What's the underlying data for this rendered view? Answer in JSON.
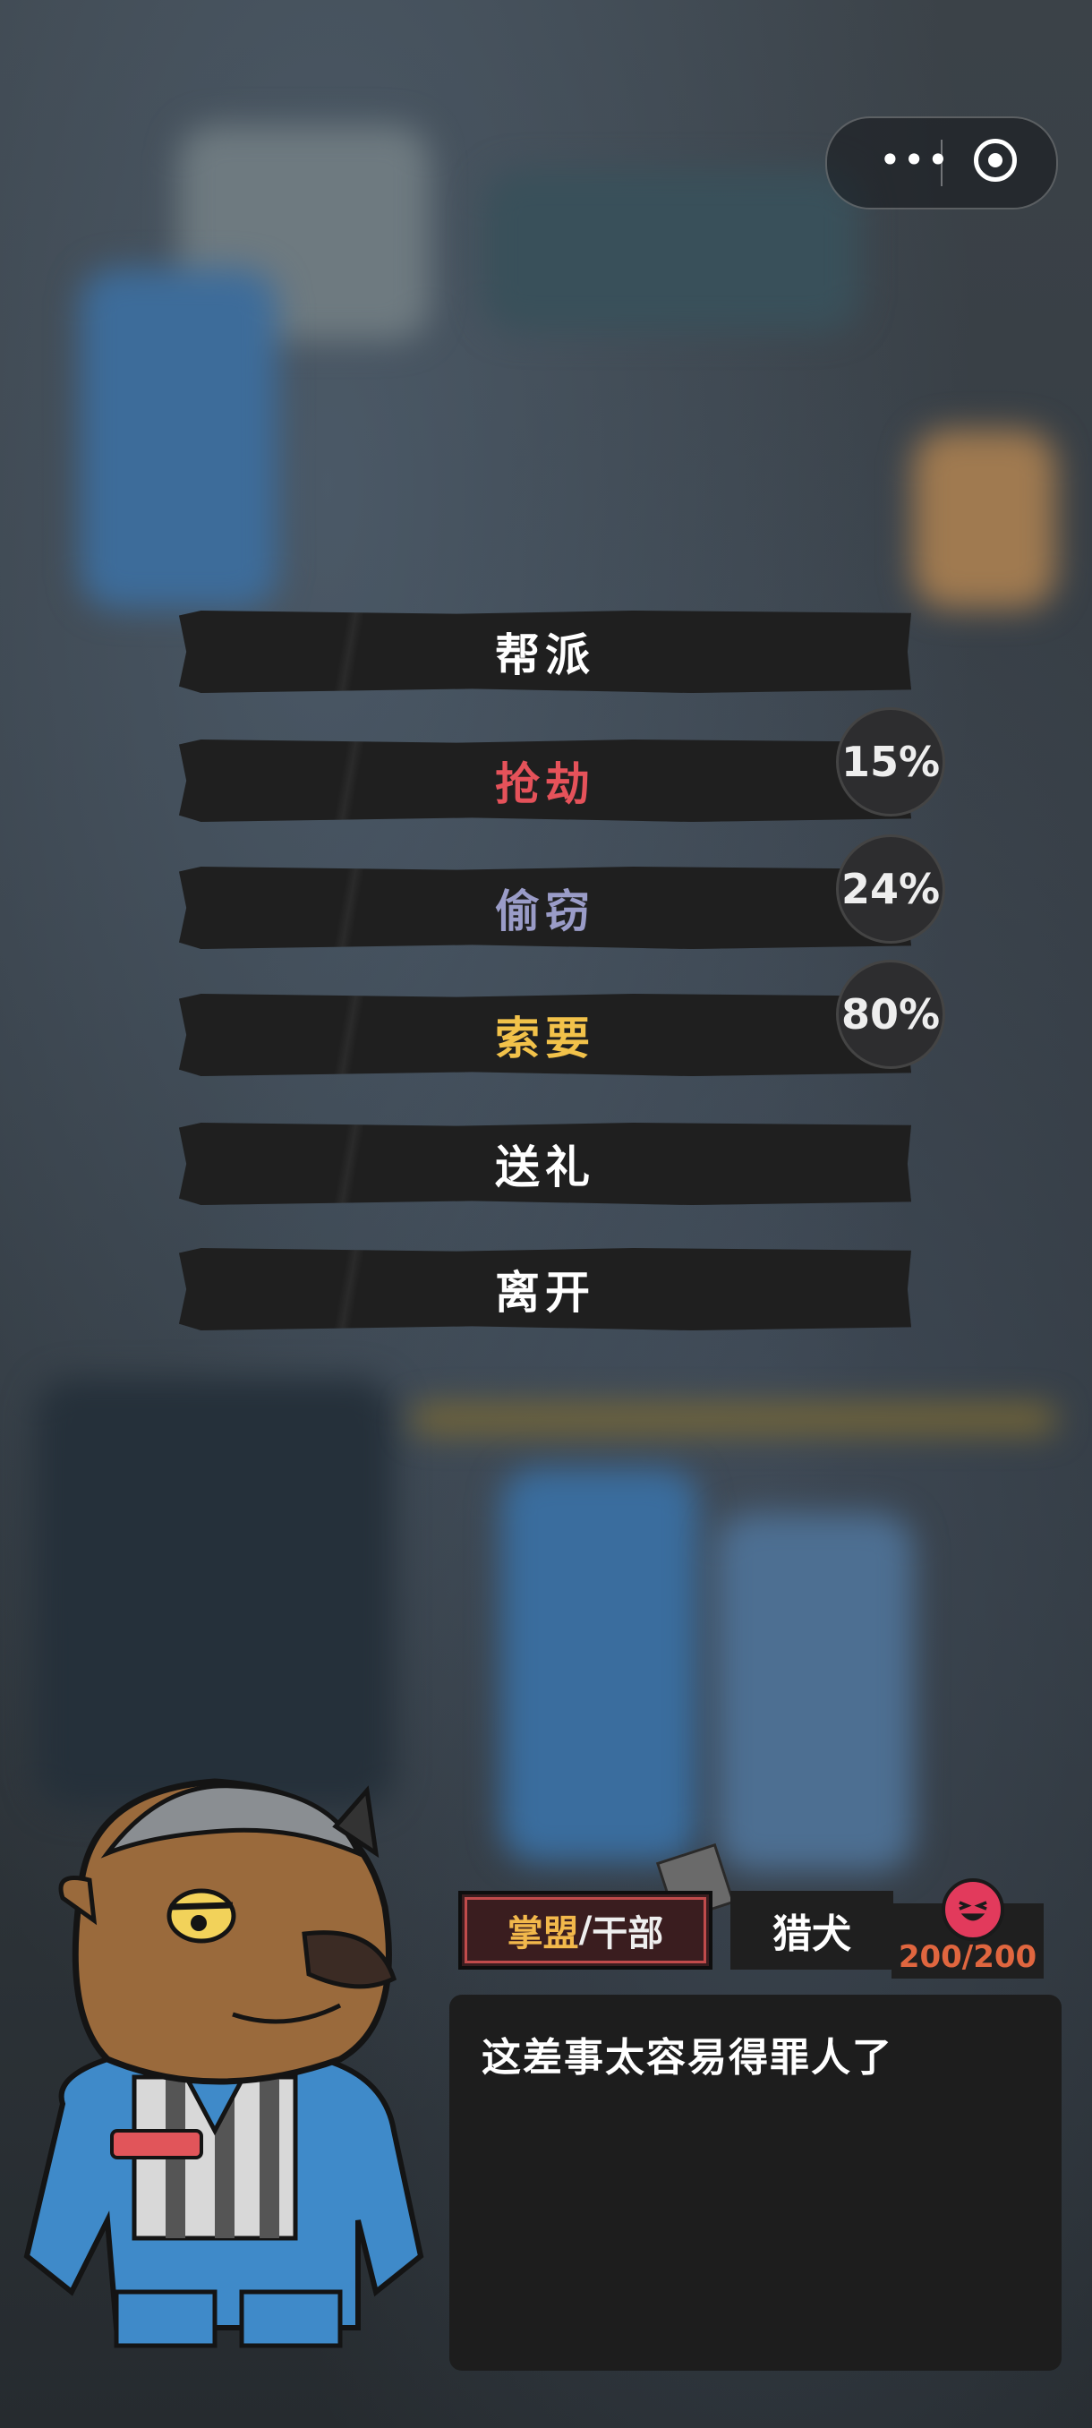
{
  "menu": {
    "items": [
      {
        "label": "帮派",
        "color": "#ffffff"
      },
      {
        "label": "抢劫",
        "color": "#e5525a",
        "chance": "15%"
      },
      {
        "label": "偷窃",
        "color": "#9a9cc8",
        "chance": "24%"
      },
      {
        "label": "索要",
        "color": "#f2c24a",
        "chance": "80%"
      },
      {
        "label": "送礼",
        "color": "#ffffff"
      },
      {
        "label": "离开",
        "color": "#ffffff"
      }
    ]
  },
  "character": {
    "role_part1": "掌盟",
    "role_sep": "/",
    "role_part2": "干部",
    "name": "猎犬",
    "hp": "200/200",
    "dialog": "这差事太容易得罪人了"
  },
  "capsule": {
    "more_icon": "more-dots-icon",
    "close_icon": "target-icon"
  }
}
